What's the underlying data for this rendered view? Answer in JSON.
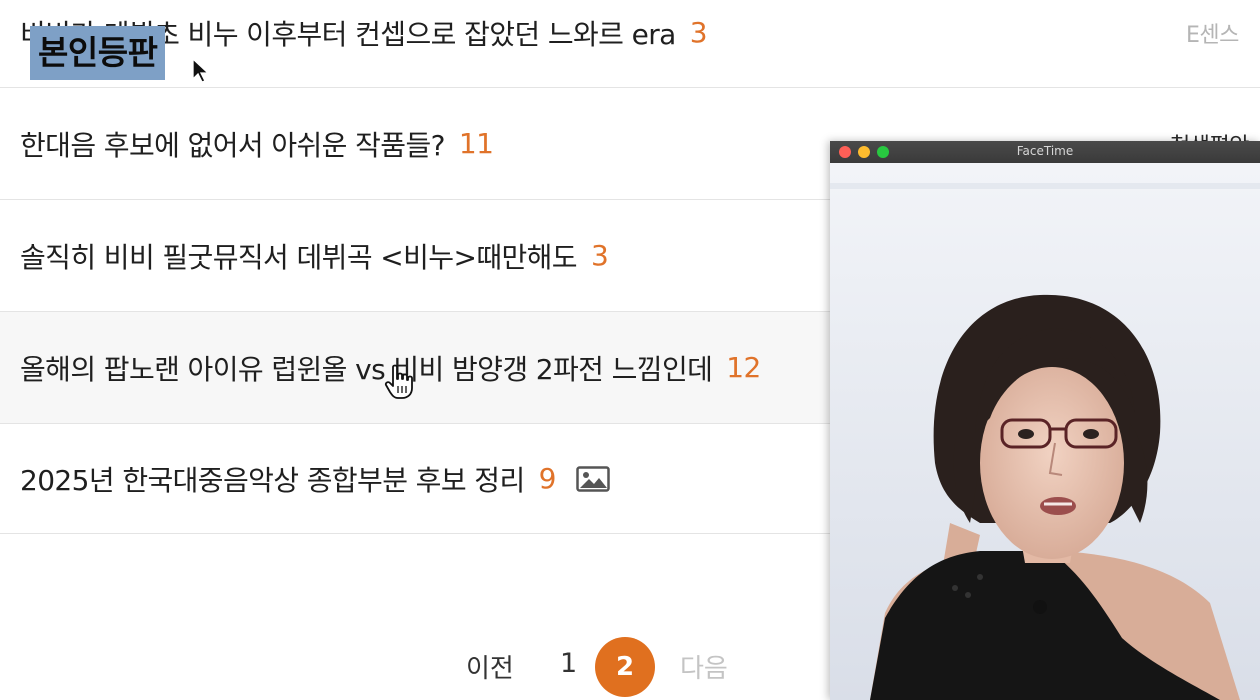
{
  "caption": {
    "text": "본인등판"
  },
  "posts": [
    {
      "title": "비비가 데뷔초 비누 이후부터 컨셉으로 잡았던 느와르 era",
      "count": "3",
      "right_text": "E센스"
    },
    {
      "title": "한대음 후보에 없어서 아쉬운 작품들?",
      "count": "11",
      "right_text": "청생평안"
    },
    {
      "title": "솔직히 비비 필굿뮤직서 데뷔곡 <비누>때만해도",
      "count": "3"
    },
    {
      "title": "올해의 팝노랜 아이유 럽윈올 vs 비비 밤양갱 2파전 느낌인데",
      "count": "12"
    },
    {
      "title": "2025년 한국대중음악상 종합부분 후보 정리",
      "count": "9",
      "icon": "image-icon"
    }
  ],
  "pagination": {
    "prev": "이전",
    "pages": [
      "1",
      "2"
    ],
    "current": "2",
    "next": "다음"
  },
  "facetime": {
    "title": "FaceTime"
  },
  "colors": {
    "accent": "#e0701f",
    "count": "#e0732a",
    "caption_bg": "#7ea0c6"
  }
}
